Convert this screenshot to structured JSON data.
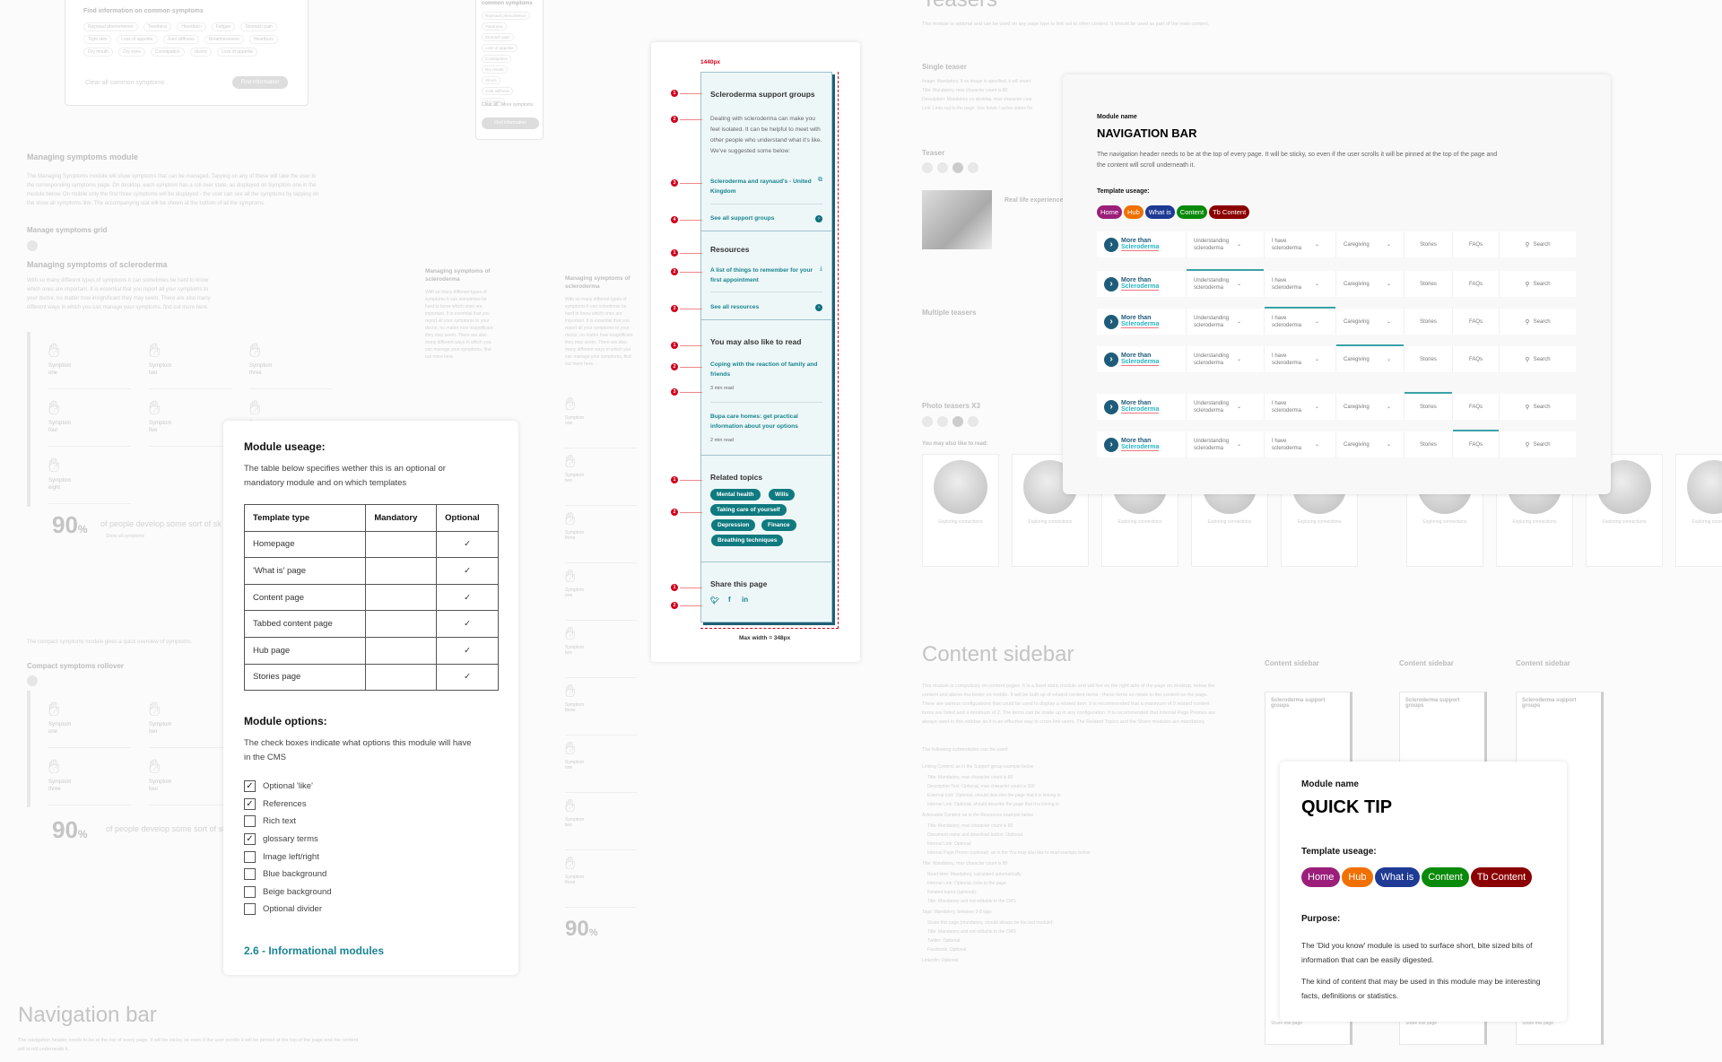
{
  "background": {
    "top_card": {
      "title": "Find information on common symptoms",
      "chips": [
        "Raynaud phenomenon",
        "Tiredness",
        "Heartburn",
        "Fatigue",
        "Stomach pain",
        "Tight skin",
        "Loss of appetite",
        "Joint stiffness",
        "Breathlessness",
        "Heartburn",
        "Dry mouth",
        "Dry eyes",
        "Constipation",
        "Ulcers",
        "Loss of appetite"
      ],
      "clear": "Clear all common symptoms",
      "button": "Find information"
    },
    "mobile_card": {
      "title": "common symptoms",
      "items": [
        "Raynaud phenomenon",
        "Tiredness",
        "Stomach pain",
        "Loss of appetite",
        "Constipation",
        "Dry mouth",
        "Ulcers",
        "Joint stiffness",
        "Dry eyes"
      ],
      "clear": "Clear all",
      "more": "More symptoms",
      "button": "Find information"
    },
    "managing_module": {
      "heading": "Managing symptoms module",
      "body": "The Managing Symptoms module will show symptoms that can be managed. Tapping on any of these will take the user to the corresponding symptoms page. On desktop, each symptom has a roll over state, as displayed on Symptom one in the module below. On mobile only the first three symptoms will be displayed - the user can see all the symptoms by tapping on the show all symptoms link. The accompanying stat will be shown at the bottom of all the symptoms.",
      "grid_heading": "Manage symptoms grid",
      "sub_heading": "Managing symptoms of scleroderma",
      "sub_body": "With so many different types of symptoms it can sometimes be hard to know which ones are important. It is essential that you report all your symptoms to your doctor, no matter how insignificant they may seem. There are also many different ways in which you can manage your symptoms, find out more here."
    },
    "symptoms": [
      "Symptom one",
      "Symptom two",
      "Symptom three",
      "Symptom four",
      "Symptom five",
      "Symptom seven",
      "Symptom eight"
    ],
    "stat": {
      "value": "90",
      "unit": "%",
      "text": "of people develop some sort of sk",
      "link": "Show all symptoms"
    },
    "compact": {
      "intro": "The compact symptoms module gives a quick overview of symptoms.",
      "heading": "Compact symptoms rollover"
    },
    "mobile_col_heading": "Managing symptoms of scleroderma",
    "nav_section": {
      "heading": "Navigation bar",
      "body": "The navigation header needs to be at the top of every page. It will be sticky, so even if the user scrolls it will be pinned at the top of the page and the content will scroll underneath it."
    },
    "teasers": {
      "heading": "Teasers",
      "body": "This module is optional and can be used on any page type to link out to other content. It should be used as part of the main content.",
      "single": "Single teaser",
      "single_list": [
        "Image: Mandatory. If no image is specified, it will revert",
        "Title: Mandatory, max character count is 80.",
        "Description: Mandatory on desktop, max character cour",
        "Link: Links out to the page. See hover / active states for"
      ],
      "teaser": "Teaser",
      "teaser_title": "Real life experience",
      "multiple": "Multiple teasers",
      "photo": "Photo teasers X3",
      "may_like": "You may also like to read:",
      "teaser_caption": "Exploring connections"
    },
    "content_sidebar": {
      "heading": "Content sidebar",
      "body": "This module is compulsory on content pages. It is a fixed static module and will live on the right side of the page on desktop, below the content and above the footer on mobile. It will be built up of related content items - these items so relate to the content on the page. There are various configuations that could be used to display a related item. It is recommended that a maximum of 9 related content items are listed and a minimum of 2. The items can be made up in any configuration. It is recommended that Internal Page Promos are always used in this sidebar as it is an effective way to cross link users. The Related Topics and the Share modules are mandatory.",
      "following": "The following submodules can be used:",
      "sub_items": [
        "Linking Content: as in the Support group example below",
        "Title: Mandatory, max character count is 80",
        "Description Text: Optional, max character count is 300",
        "External Link: Optional, should describe the page that it is linking to",
        "Internal Link: Optional, should describe the page that it is linking to",
        "Actionable Content: as in the Resources example below",
        "Title: Mandatory, max character count is 80",
        "Document name and download button: Optional",
        "Internal Link: Optional",
        "Internal Page Promo (optional): as in the You may also like to read example below",
        "Title: Mandatory, max character count is 80",
        "Read time: Mandatory, calculated automatically",
        "Internal Link: Optional, links to the page",
        "Related topics (optional):",
        "Title: Mandatory and not editable in the CMS",
        "Tags: Mandatory, between 3-8 tags",
        "Share this page (mandatory, should always be the last module):",
        "Title: Mandatory and not editable in the CMS",
        "Twitter: Optional",
        "Facebook: Optional",
        "LinkedIn: Optional"
      ],
      "mini_title": "Content sidebar",
      "mini_heading": "Scleroderma support groups",
      "mini_share": "Share this page"
    }
  },
  "module_usage": {
    "title": "Module useage:",
    "description": "The table below specifies wether this is an optional or mandatory module and on which templates",
    "columns": [
      "Template type",
      "Mandatory",
      "Optional"
    ],
    "rows": [
      {
        "template": "Homepage",
        "mandatory": "",
        "optional": "✓"
      },
      {
        "template": "'What is' page",
        "mandatory": "",
        "optional": "✓"
      },
      {
        "template": "Content page",
        "mandatory": "",
        "optional": "✓"
      },
      {
        "template": "Tabbed content page",
        "mandatory": "",
        "optional": "✓"
      },
      {
        "template": "Hub page",
        "mandatory": "",
        "optional": "✓"
      },
      {
        "template": "Stories page",
        "mandatory": "",
        "optional": "✓"
      }
    ],
    "options_title": "Module options:",
    "options_description": "The check boxes indicate what options this module will have in the CMS",
    "options": [
      {
        "label": "Optional 'like'",
        "checked": true
      },
      {
        "label": "References",
        "checked": true
      },
      {
        "label": "Rich text",
        "checked": false
      },
      {
        "label": "glossary terms",
        "checked": true
      },
      {
        "label": "Image left/right",
        "checked": false
      },
      {
        "label": "Blue background",
        "checked": false
      },
      {
        "label": "Beige background",
        "checked": false
      },
      {
        "label": "Optional divider",
        "checked": false
      }
    ],
    "link": "2.6 - Informational modules"
  },
  "sidebar_mock": {
    "width_label": "1440px",
    "max_width_label": "Max width = 348px",
    "support": {
      "title": "Scleroderma support groups",
      "body": "Dealing with scleroderma can make you feel isolated. It can be helpful to meet with other people who understand what it's like. We've suggested some below:",
      "link": "Scleroderma and raynaud's - United Kingdom",
      "see_all": "See all support groups"
    },
    "resources": {
      "title": "Resources",
      "link": "A list of things to remember for your first appointment",
      "see_all": "See all resources"
    },
    "read": {
      "title": "You may also like to read",
      "items": [
        {
          "title": "Coping with the reaction of family and friends",
          "time": "3 min read"
        },
        {
          "title": "Bupa care homes: get practical information about your options",
          "time": "2 min read"
        }
      ]
    },
    "topics": {
      "title": "Related topics",
      "tags": [
        "Mental health",
        "Wills",
        "Taking care of yourself",
        "Depression",
        "Finance",
        "Breathing techniques"
      ]
    },
    "share": {
      "title": "Share this page",
      "icons": [
        "twitter-icon",
        "facebook-icon",
        "linkedin-icon"
      ]
    },
    "annotations": [
      "1",
      "2",
      "3",
      "4",
      "1",
      "2",
      "3",
      "1",
      "2",
      "3",
      "1",
      "2",
      "1",
      "2"
    ]
  },
  "nav_card": {
    "module_label": "Module name",
    "title": "NAVIGATION BAR",
    "description": "The navigation header needs to be at the top of every page. It will be sticky, so even if the user scrolls it will be pinned at the top of the page and the content will scroll underneath it.",
    "template_label": "Template useage:",
    "templates": [
      {
        "label": "Home",
        "color": "#9b1f7a"
      },
      {
        "label": "Hub",
        "color": "#f07000"
      },
      {
        "label": "What is",
        "color": "#1e3a94"
      },
      {
        "label": "Content",
        "color": "#0a8a0a"
      },
      {
        "label": "Tb Content",
        "color": "#8b0000"
      }
    ],
    "logo": {
      "line1": "More than",
      "line2": "Scleroderma"
    },
    "nav_items": [
      {
        "label": "Understanding scleroderma",
        "dropdown": true
      },
      {
        "label": "I have scleroderma",
        "dropdown": true
      },
      {
        "label": "Caregiving",
        "dropdown": true
      },
      {
        "label": "Stories",
        "dropdown": false
      },
      {
        "label": "FAQs",
        "dropdown": false
      }
    ],
    "search": "Search",
    "active_states": [
      "none",
      "Understanding scleroderma",
      "I have scleroderma",
      "Caregiving",
      "Stories",
      "FAQs"
    ],
    "accent": "#3aa2a8"
  },
  "quick_tip": {
    "module_label": "Module name",
    "title": "QUICK TIP",
    "template_label": "Template useage:",
    "templates": [
      {
        "label": "Home",
        "color": "#9b1f7a"
      },
      {
        "label": "Hub",
        "color": "#f07000"
      },
      {
        "label": "What is",
        "color": "#1e3a94"
      },
      {
        "label": "Content",
        "color": "#0a8a0a"
      },
      {
        "label": "Tb Content",
        "color": "#8b0000"
      }
    ],
    "purpose_label": "Purpose:",
    "purpose": [
      "The 'Did you know' module is used to surface short, bite sized bits of information that can be easily digested.",
      "The kind of content that may be used in this module may be interesting facts, definitions or statistics."
    ]
  }
}
